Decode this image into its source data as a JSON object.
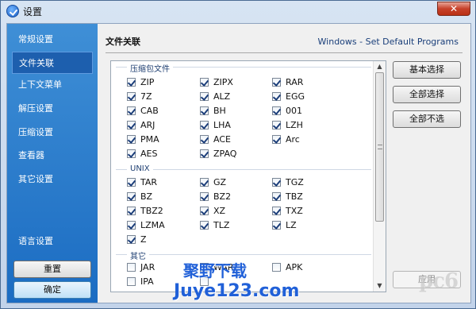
{
  "window": {
    "title": "设置",
    "close_glyph": "✕"
  },
  "sidebar": {
    "items": [
      {
        "label": "常规设置"
      },
      {
        "label": "文件关联"
      },
      {
        "label": "上下文菜单"
      },
      {
        "label": "解压设置"
      },
      {
        "label": "压缩设置"
      },
      {
        "label": "查看器"
      },
      {
        "label": "其它设置"
      },
      {
        "label": "语言设置"
      }
    ],
    "active_index": 1,
    "reset_label": "重置",
    "ok_label": "确定"
  },
  "main": {
    "title": "文件关联",
    "subtitle": "Windows - Set Default Programs",
    "groups": [
      {
        "label": "压缩包文件",
        "items": [
          {
            "label": "ZIP",
            "checked": true
          },
          {
            "label": "ZIPX",
            "checked": true
          },
          {
            "label": "RAR",
            "checked": true
          },
          {
            "label": "7Z",
            "checked": true
          },
          {
            "label": "ALZ",
            "checked": true
          },
          {
            "label": "EGG",
            "checked": true
          },
          {
            "label": "CAB",
            "checked": true
          },
          {
            "label": "BH",
            "checked": true
          },
          {
            "label": "001",
            "checked": true
          },
          {
            "label": "ARJ",
            "checked": true
          },
          {
            "label": "LHA",
            "checked": true
          },
          {
            "label": "LZH",
            "checked": true
          },
          {
            "label": "PMA",
            "checked": true
          },
          {
            "label": "ACE",
            "checked": true
          },
          {
            "label": "Arc",
            "checked": true
          },
          {
            "label": "AES",
            "checked": true
          },
          {
            "label": "ZPAQ",
            "checked": true
          }
        ]
      },
      {
        "label": "UNIX",
        "items": [
          {
            "label": "TAR",
            "checked": true
          },
          {
            "label": "GZ",
            "checked": true
          },
          {
            "label": "TGZ",
            "checked": true
          },
          {
            "label": "BZ",
            "checked": true
          },
          {
            "label": "BZ2",
            "checked": true
          },
          {
            "label": "TBZ",
            "checked": true
          },
          {
            "label": "TBZ2",
            "checked": true
          },
          {
            "label": "XZ",
            "checked": true
          },
          {
            "label": "TXZ",
            "checked": true
          },
          {
            "label": "LZMA",
            "checked": true
          },
          {
            "label": "TLZ",
            "checked": true
          },
          {
            "label": "LZ",
            "checked": true
          },
          {
            "label": "Z",
            "checked": true
          }
        ]
      },
      {
        "label": "其它",
        "items": [
          {
            "label": "JAR",
            "checked": false
          },
          {
            "label": "WAR",
            "checked": false
          },
          {
            "label": "APK",
            "checked": false
          },
          {
            "label": "IPA",
            "checked": false
          },
          {
            "label": "",
            "checked": false
          }
        ]
      }
    ],
    "buttons": {
      "basic": "基本选择",
      "select_all": "全部选择",
      "deselect_all": "全部不选",
      "apply": "应用"
    }
  },
  "watermark": {
    "line1": "聚野下载",
    "line2": "Juye123.com",
    "logo": "pc6"
  }
}
